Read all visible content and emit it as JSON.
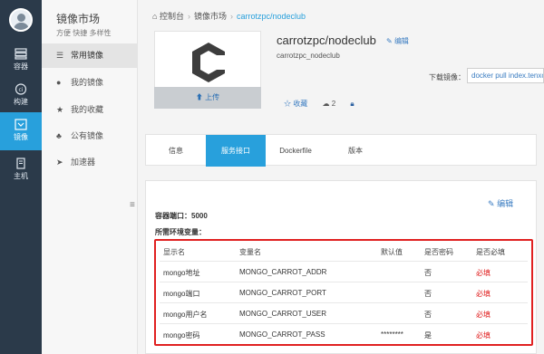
{
  "nav": {
    "items": [
      {
        "label": "容器",
        "icon": "server-icon"
      },
      {
        "label": "构建",
        "icon": "copyright-icon"
      },
      {
        "label": "镜像",
        "icon": "image-box-icon",
        "active": true
      },
      {
        "label": "主机",
        "icon": "host-icon"
      }
    ]
  },
  "sidebar": {
    "title": "镜像市场",
    "subtitle": "方便 快捷 多样性",
    "items": [
      {
        "label": "常用镜像",
        "active": true
      },
      {
        "label": "我的镜像"
      },
      {
        "label": "我的收藏"
      },
      {
        "label": "公有镜像"
      },
      {
        "label": "加速器"
      }
    ]
  },
  "breadcrumb": {
    "home": "控制台",
    "market": "镜像市场",
    "current": "carrotzpc/nodeclub"
  },
  "repo": {
    "title": "carrotzpc/nodeclub",
    "edit_label": "编辑",
    "subtitle": "carrotzpc_nodeclub",
    "upload_label": "上传",
    "download_label": "下载镜像：",
    "download_cmd": "docker pull index.tenxcloud.com/carrotzpc/nodeclub",
    "favorite_label": "收藏",
    "stars": "2"
  },
  "tabs": [
    "信息",
    "服务接口",
    "Dockerfile",
    "版本"
  ],
  "active_tab": 1,
  "panel": {
    "edit_label": "编辑",
    "port_text": "容器端口：5000",
    "env_title": "所需环境变量：",
    "columns": [
      "显示名",
      "变量名",
      "默认值",
      "是否密码",
      "是否必填"
    ],
    "rows": [
      {
        "display": "mongo地址",
        "var": "MONGO_CARROT_ADDR",
        "default": "",
        "password": "否",
        "required": "必填"
      },
      {
        "display": "mongo端口",
        "var": "MONGO_CARROT_PORT",
        "default": "",
        "password": "否",
        "required": "必填"
      },
      {
        "display": "mongo用户名",
        "var": "MONGO_CARROT_USER",
        "default": "",
        "password": "否",
        "required": "必填"
      },
      {
        "display": "mongo密码",
        "var": "MONGO_CARROT_PASS",
        "default": "********",
        "password": "是",
        "required": "必填"
      }
    ]
  },
  "colors": {
    "nav_bg": "#2b3a4a",
    "accent": "#28a0dc",
    "link": "#3a7cc1",
    "required_red": "#e02020"
  }
}
